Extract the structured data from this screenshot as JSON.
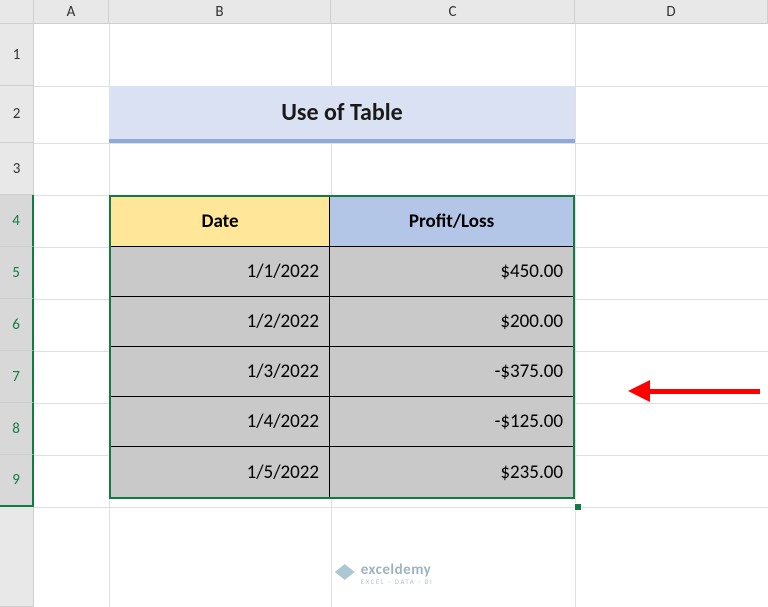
{
  "columns": {
    "A": "A",
    "B": "B",
    "C": "C",
    "D": "D"
  },
  "rows": {
    "r1": "1",
    "r2": "2",
    "r3": "3",
    "r4": "4",
    "r5": "5",
    "r6": "6",
    "r7": "7",
    "r8": "8",
    "r9": "9"
  },
  "title": "Use of Table",
  "table": {
    "headers": {
      "date": "Date",
      "profit_loss": "Profit/Loss"
    },
    "rows": [
      {
        "date": "1/1/2022",
        "value": "$450.00"
      },
      {
        "date": "1/2/2022",
        "value": "$200.00"
      },
      {
        "date": "1/3/2022",
        "value": "-$375.00"
      },
      {
        "date": "1/4/2022",
        "value": "-$125.00"
      },
      {
        "date": "1/5/2022",
        "value": "$235.00"
      }
    ]
  },
  "watermark": {
    "title": "exceldemy",
    "subtitle": "EXCEL · DATA · BI"
  }
}
